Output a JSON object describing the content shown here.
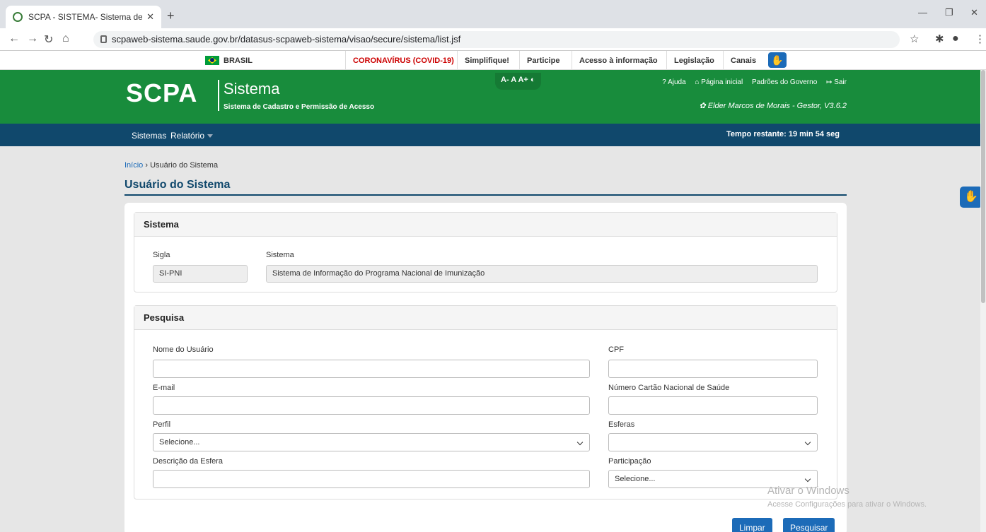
{
  "browser": {
    "tab_title": "SCPA - SISTEMA- Sistema de Cad",
    "new_tab": "+",
    "url": "scpaweb-sistema.saude.gov.br/datasus-scpaweb-sistema/visao/secure/sistema/list.jsf"
  },
  "govbar": {
    "brasil": "BRASIL",
    "covid": "CORONAVÍRUS (COVID-19)",
    "simplifique": "Simplifique!",
    "participe": "Participe",
    "acesso": "Acesso à informação",
    "legislacao": "Legislação",
    "canais": "Canais"
  },
  "header": {
    "logo": "SCPA",
    "title": "Sistema",
    "subtitle": "Sistema de Cadastro e Permissão de Acesso",
    "font_controls": "A- A A+ ◐",
    "links": [
      "? Ajuda",
      "⌂ Página inicial",
      "Padrões do Governo",
      "↦ Sair"
    ],
    "user": "✿ Elder Marcos de Morais - Gestor, V3.6.2"
  },
  "menu": {
    "sistemas": "Sistemas",
    "relatorio": "Relatório",
    "timer": "Tempo restante: 19 min 54 seg"
  },
  "breadcrumb": {
    "home": "Início",
    "sep": "›",
    "current": "Usuário do Sistema"
  },
  "page_title": "Usuário do Sistema",
  "sistema_panel": {
    "heading": "Sistema",
    "sigla_label": "Sigla",
    "sigla_value": "SI-PNI",
    "sistema_label": "Sistema",
    "sistema_value": "Sistema de Informação do Programa Nacional de Imunização"
  },
  "pesquisa_panel": {
    "heading": "Pesquisa",
    "nome_label": "Nome do Usuário",
    "cpf_label": "CPF",
    "email_label": "E-mail",
    "cns_label": "Número Cartão Nacional de Saúde",
    "perfil_label": "Perfil",
    "perfil_value": "Selecione...",
    "esferas_label": "Esferas",
    "esferas_value": "",
    "descricao_label": "Descrição da Esfera",
    "participacao_label": "Participação",
    "participacao_value": "Selecione..."
  },
  "buttons": {
    "limpar": "Limpar",
    "pesquisar": "Pesquisar"
  },
  "watermark": {
    "line1": "Ativar o Windows",
    "line2": "Acesse Configurações para ativar o Windows."
  },
  "colors": {
    "green": "#188c3c",
    "navy": "#10486c",
    "blue": "#1c6bb8"
  }
}
